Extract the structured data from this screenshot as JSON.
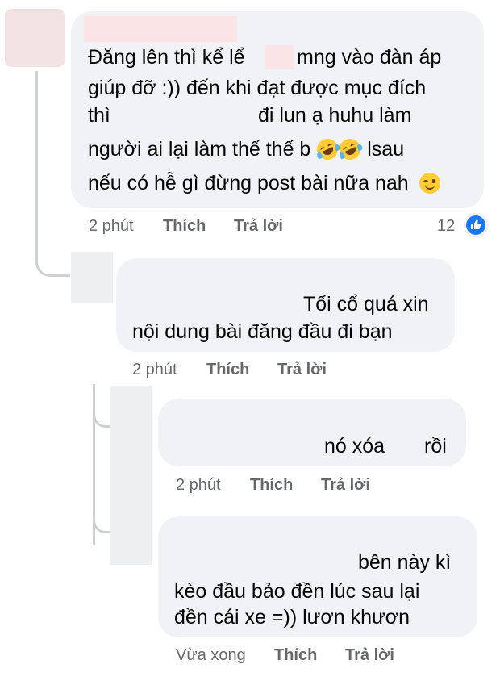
{
  "comment1": {
    "lines": [
      "Đăng lên thì kể lể",
      "mng vào đàn áp",
      "giúp đỡ :)) đến khi đạt được mục đích",
      "thì",
      "đi lun ạ huhu làm",
      "người ai lại làm thế thế b",
      "lsau",
      "nếu có hễ gì đừng post bài nữa nah"
    ],
    "time": "2 phút",
    "like_label": "Thích",
    "reply_label": "Trả lời",
    "reaction_count": "12"
  },
  "reply1": {
    "lines": [
      "Tối cổ quá xin",
      "nội dung bài đăng đầu đi bạn"
    ],
    "time": "2 phút",
    "like_label": "Thích",
    "reply_label": "Trả lời"
  },
  "reply2": {
    "text_left": "nó xóa",
    "text_right": "rồi",
    "time": "2 phút",
    "like_label": "Thích",
    "reply_label": "Trả lời"
  },
  "reply3": {
    "lines": [
      "bên này kì",
      "kèo đầu bảo đền lúc sau lại",
      "đền cái xe =)) lươn khươn"
    ],
    "time": "Vừa xong",
    "like_label": "Thích",
    "reply_label": "Trả lời"
  },
  "icons": {
    "comment1_emojis": [
      "rofl-emoji",
      "rofl-emoji"
    ],
    "comment1_end_emoji": "wink-emoji",
    "reaction": "like-icon"
  },
  "colors": {
    "accent": "#1877f2",
    "bubble": "#f0f2f5",
    "meta": "#65676b"
  }
}
